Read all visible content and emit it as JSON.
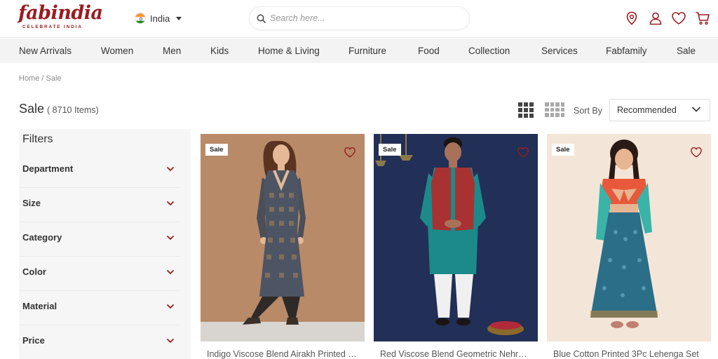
{
  "brand": {
    "logo_text": "fabindia",
    "tagline": "CELEBRATE INDIA",
    "color": "#9a1c20"
  },
  "header": {
    "country": "India",
    "search_placeholder": "Search here...",
    "icons": [
      "location-pin-icon",
      "user-icon",
      "heart-icon",
      "cart-icon"
    ]
  },
  "nav": {
    "items": [
      "New Arrivals",
      "Women",
      "Men",
      "Kids",
      "Home & Living",
      "Furniture",
      "Food",
      "Collection",
      "Services",
      "Fabfamily",
      "Sale"
    ]
  },
  "breadcrumb": "Home / Sale",
  "listing": {
    "title": "Sale",
    "count": "( 8710 Items)",
    "sort_label": "Sort By",
    "sort_value": "Recommended"
  },
  "filters": {
    "title": "Filters",
    "items": [
      "Department",
      "Size",
      "Category",
      "Color",
      "Material",
      "Price"
    ]
  },
  "products": [
    {
      "badge": "Sale",
      "name": "Indigo Viscose Blend Airakh Printed Kurta"
    },
    {
      "badge": "Sale",
      "name": "Red Viscose Blend Geometric Nehru Jacket"
    },
    {
      "badge": "Sale",
      "name": "Blue Cotton Printed 3Pc Lehenga Set"
    }
  ],
  "colors": {
    "accent": "#9a1c20",
    "nav_bg": "#f3f3f3",
    "filters_bg": "#f6f6f6"
  }
}
